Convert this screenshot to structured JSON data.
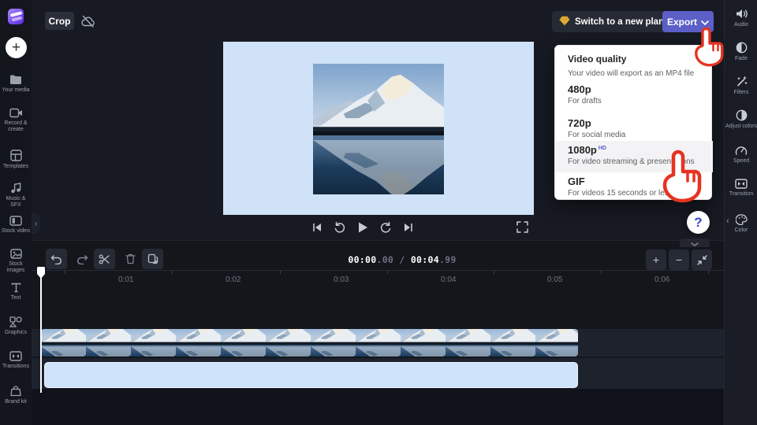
{
  "topbar": {
    "crop_label": "Crop",
    "plan_button_label": "Switch to a new plan",
    "export_button_label": "Export"
  },
  "export_menu": {
    "title": "Video quality",
    "subtitle": "Your video will export as an MP4 file",
    "options": [
      {
        "label": "480p",
        "badge": "",
        "desc": "For drafts"
      },
      {
        "label": "720p",
        "badge": "",
        "desc": "For social media"
      },
      {
        "label": "1080p",
        "badge": "HD",
        "desc": "For video streaming & presentations"
      },
      {
        "label": "GIF",
        "badge": "",
        "desc": "For videos 15 seconds or less"
      }
    ]
  },
  "left_rail": {
    "add_label": "+",
    "items": [
      {
        "label": "Your media",
        "icon": "folder-icon"
      },
      {
        "label": "Record & create",
        "icon": "record-camera-icon"
      },
      {
        "label": "Templates",
        "icon": "templates-icon"
      },
      {
        "label": "Music & SFX",
        "icon": "music-note-icon"
      },
      {
        "label": "Stock video",
        "icon": "stock-video-icon"
      },
      {
        "label": "Stock images",
        "icon": "stock-images-icon"
      },
      {
        "label": "Text",
        "icon": "text-icon"
      },
      {
        "label": "Graphics",
        "icon": "graphics-icon"
      },
      {
        "label": "Transitions",
        "icon": "transitions-icon"
      },
      {
        "label": "Brand kit",
        "icon": "brand-kit-icon"
      }
    ]
  },
  "right_rail": {
    "items": [
      {
        "label": "Audio",
        "icon": "audio-icon"
      },
      {
        "label": "Fade",
        "icon": "fade-icon"
      },
      {
        "label": "Filters",
        "icon": "filters-icon"
      },
      {
        "label": "Adjust colors",
        "icon": "adjust-colors-icon"
      },
      {
        "label": "Speed",
        "icon": "speed-icon"
      },
      {
        "label": "Transition",
        "icon": "transition-icon"
      },
      {
        "label": "Color",
        "icon": "color-icon"
      }
    ]
  },
  "timeline": {
    "timecode": {
      "current": "00:00",
      "current_frac": ".00",
      "separator": " / ",
      "total": "00:04",
      "total_frac": ".99"
    },
    "ruler_labels": [
      "0:01",
      "0:02",
      "0:03",
      "0:04",
      "0:05",
      "0:06"
    ],
    "zoom_in_label": "+",
    "zoom_out_label": "−"
  },
  "help_label": "?",
  "colors": {
    "accent": "#5b5fc7",
    "canvas_blue": "#cfe2f7",
    "clip_blue": "#cfe4fb",
    "cursor_red": "#e63322",
    "gem_gold": "#eab13a"
  }
}
